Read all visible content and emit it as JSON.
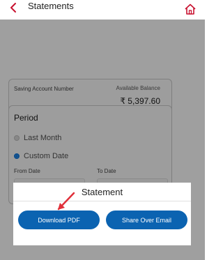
{
  "header": {
    "title": "Statements",
    "back_icon": "chevron-left-icon",
    "home_icon": "home-icon",
    "accent": "#c8102e"
  },
  "account_card": {
    "account_label": "Saving Account Number",
    "balance_label": "Available Balance",
    "balance_value": "₹ 5,397.60"
  },
  "period": {
    "title": "Period",
    "options": [
      {
        "label": "Last Month",
        "selected": false
      },
      {
        "label": "Custom Date",
        "selected": true
      }
    ],
    "from_label": "From Date",
    "to_label": "To Date"
  },
  "modal": {
    "title": "Statement",
    "download_pdf": "Download PDF",
    "share_email": "Share Over Email",
    "button_color": "#0b63b1",
    "arrow_color": "#e0303a"
  }
}
